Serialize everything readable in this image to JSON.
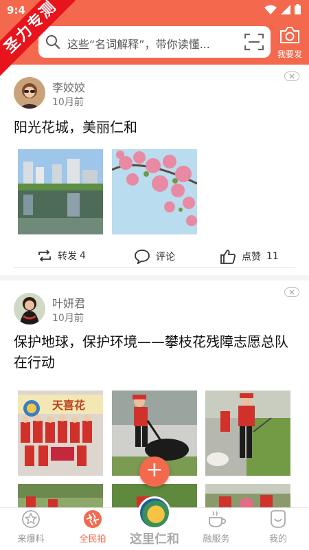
{
  "status": {
    "time": "9:4"
  },
  "ribbon": "圣力专测",
  "search": {
    "placeholder": "这些“名词解释”，带你读懂..."
  },
  "header": {
    "post_label": "我要发"
  },
  "posts": [
    {
      "author": "李姣姣",
      "time": "10月前",
      "title": "阳光花城，美丽仁和",
      "actions": {
        "share_label": "转发",
        "share_count": "4",
        "comment_label": "评论",
        "like_label": "点赞",
        "like_count": "11"
      }
    },
    {
      "author": "叶妍君",
      "time": "10月前",
      "title": "保护地球，保护环境——攀枝花残障志愿总队在行动",
      "photo_banner_text": "天喜花"
    }
  ],
  "fab": {
    "label": "+"
  },
  "bottom_nav": [
    {
      "label": "来爆料",
      "icon": "star-badge-icon"
    },
    {
      "label": "全民拍",
      "icon": "shutter-icon",
      "active": true
    },
    {
      "label": "这里仁和",
      "icon": "logo-icon"
    },
    {
      "label": "融服务",
      "icon": "coffee-cup-icon"
    },
    {
      "label": "我的",
      "icon": "smile-face-icon"
    }
  ],
  "colors": {
    "accent": "#f4694d",
    "ribbon": "#e8131c"
  }
}
